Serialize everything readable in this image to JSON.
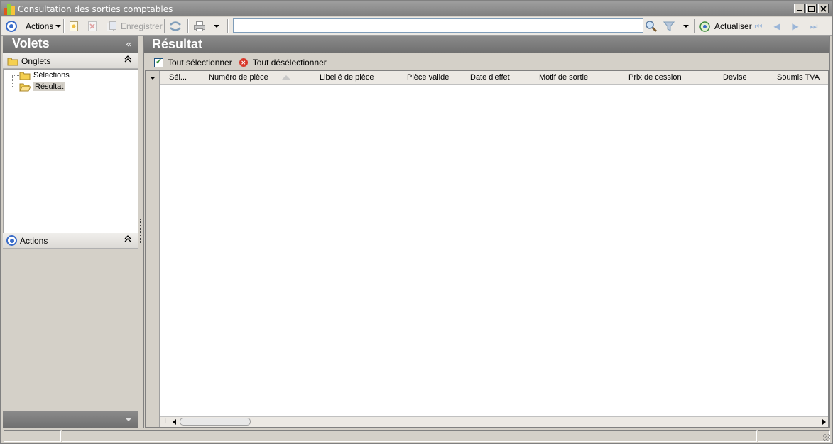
{
  "window": {
    "title": "Consultation des sorties comptables"
  },
  "toolbar": {
    "actions_label": "Actions",
    "save_label": "Enregistrer",
    "search_value": "",
    "refresh_label": "Actualiser"
  },
  "left_panel": {
    "title": "Volets",
    "collapse_glyph": "«",
    "tabs_section": {
      "label": "Onglets",
      "items": [
        {
          "label": "Sélections",
          "selected": false
        },
        {
          "label": "Résultat",
          "selected": true
        }
      ]
    },
    "actions_section": {
      "label": "Actions"
    }
  },
  "right_panel": {
    "title": "Résultat",
    "select_all_label": "Tout sélectionner",
    "deselect_all_label": "Tout désélectionner",
    "columns": [
      "Sél...",
      "Numéro de pièce",
      "Libellé de pièce",
      "Pièce valide",
      "Date d'effet",
      "Motif de sortie",
      "Prix de cession",
      "Devise",
      "Soumis TVA"
    ],
    "rows": []
  },
  "icons": {
    "app": "app-logo-icon",
    "actions": "actions-circle-icon",
    "new": "new-document-icon",
    "delete": "delete-icon",
    "save": "save-icon",
    "sync": "sync-icon",
    "print": "print-icon",
    "search": "search-icon",
    "filter": "filter-icon",
    "refresh": "refresh-icon"
  },
  "colors": {
    "accent": "#3a6cc8",
    "header_bg": "#7f7f7f",
    "error": "#d8382a"
  }
}
